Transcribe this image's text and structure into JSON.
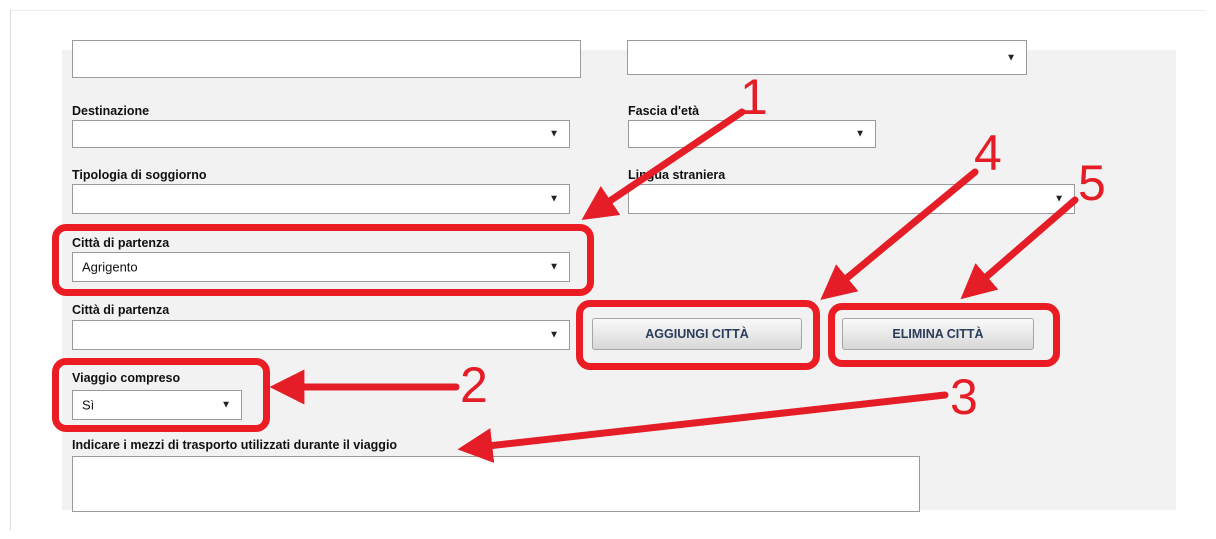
{
  "form": {
    "destinazione_label": "Destinazione",
    "destinazione_value": "",
    "fascia_label": "Fascia d'età",
    "fascia_value": "",
    "tipologia_label": "Tipologia di soggiorno",
    "tipologia_value": "",
    "lingua_label": "Lingua straniera",
    "lingua_value": "",
    "citta1_label": "Città di partenza",
    "citta1_value": "Agrigento",
    "citta2_label": "Città di partenza",
    "citta2_value": "",
    "viaggio_label": "Viaggio compreso",
    "viaggio_value": "Sì",
    "mezzi_label": "Indicare i mezzi di trasporto utilizzati durante il viaggio",
    "mezzi_value": "",
    "add_button": "AGGIUNGI CITTÀ",
    "delete_button": "ELIMINA CITTÀ",
    "caret": "▼"
  },
  "annotations": {
    "n1": "1",
    "n2": "2",
    "n3": "3",
    "n4": "4",
    "n5": "5",
    "color": "#e41d26"
  }
}
